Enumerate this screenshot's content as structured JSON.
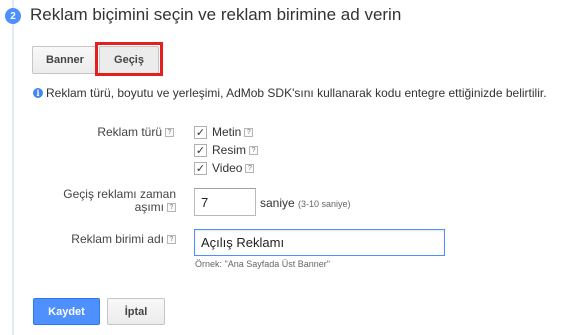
{
  "step": {
    "number": "2",
    "title": "Reklam biçimini seçin ve reklam birimine ad verin"
  },
  "formats": {
    "banner": "Banner",
    "interstitial": "Geçiş",
    "selected": "interstitial"
  },
  "info": "Reklam türü, boyutu ve yerleşimi, AdMob SDK'sını kullanarak kodu entegre ettiğinizde belirtilir.",
  "ad_type": {
    "label": "Reklam türü",
    "options": [
      {
        "label": "Metin",
        "checked": true
      },
      {
        "label": "Resim",
        "checked": true
      },
      {
        "label": "Video",
        "checked": true
      }
    ]
  },
  "timeout": {
    "label_line1": "Geçiş reklamı zaman",
    "label_line2": "aşımı",
    "value": "7",
    "unit": "saniye",
    "range": "(3-10 saniye)"
  },
  "ad_unit_name": {
    "label": "Reklam birimi adı",
    "value": "Açılış Reklamı",
    "example": "Örnek: \"Ana Sayfada Üst Banner\""
  },
  "actions": {
    "save": "Kaydet",
    "cancel": "İptal"
  },
  "icons": {
    "help": "?",
    "check": "✓",
    "info": "i"
  },
  "colors": {
    "primary": "#4d90fe",
    "highlight": "#e51e1e"
  }
}
